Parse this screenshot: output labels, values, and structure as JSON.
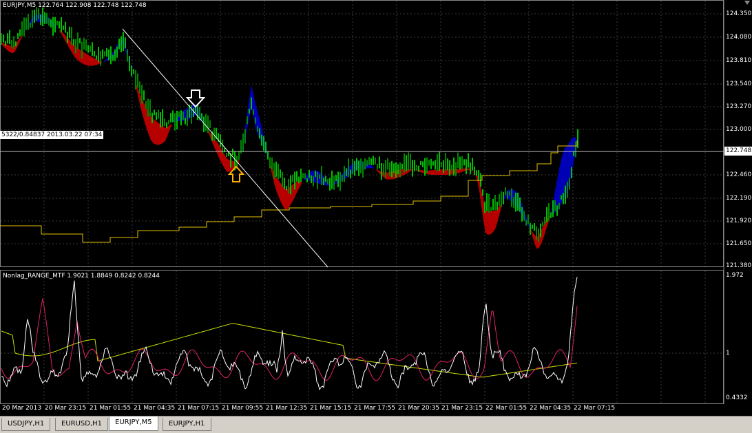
{
  "main_chart": {
    "symbol_info": "EURJPY,M5  122.764 122.908 122.748 122.748",
    "price_labels": [
      "124.350",
      "124.080",
      "123.810",
      "123.540",
      "123.270",
      "123.000",
      "122.460",
      "122.190",
      "121.920",
      "121.650",
      "121.380"
    ],
    "current_price": "122.748",
    "crosshair_label": "5322/0.84837 2013.03.22 07:34",
    "colors": {
      "bull_candle": "#00c000",
      "bear_candle": "#008000",
      "band_up": "#0000c0",
      "band_down": "#c00000",
      "yellow_line": "#e6c200",
      "arrow_down": "#ffffff",
      "arrow_up": "#ffb000"
    }
  },
  "indicator": {
    "title": "Nonlag_RANGE_MTF 1.9021 1.8849 0.8242 0.8244",
    "scale_labels": [
      "1.972",
      "1",
      "0.4332"
    ]
  },
  "time_axis": [
    "20 Mar 2013",
    "20 Mar 23:15",
    "21 Mar 01:55",
    "21 Mar 04:35",
    "21 Mar 07:15",
    "21 Mar 09:55",
    "21 Mar 12:35",
    "21 Mar 15:15",
    "21 Mar 17:55",
    "21 Mar 20:35",
    "21 Mar 23:15",
    "22 Mar 01:55",
    "22 Mar 04:35",
    "22 Mar 07:15"
  ],
  "tabs": [
    {
      "label": "USDJPY,H1",
      "active": false
    },
    {
      "label": "EURUSD,H1",
      "active": false
    },
    {
      "label": "EURJPY,M5",
      "active": true
    },
    {
      "label": "EURJPY,H1",
      "active": false
    }
  ]
}
